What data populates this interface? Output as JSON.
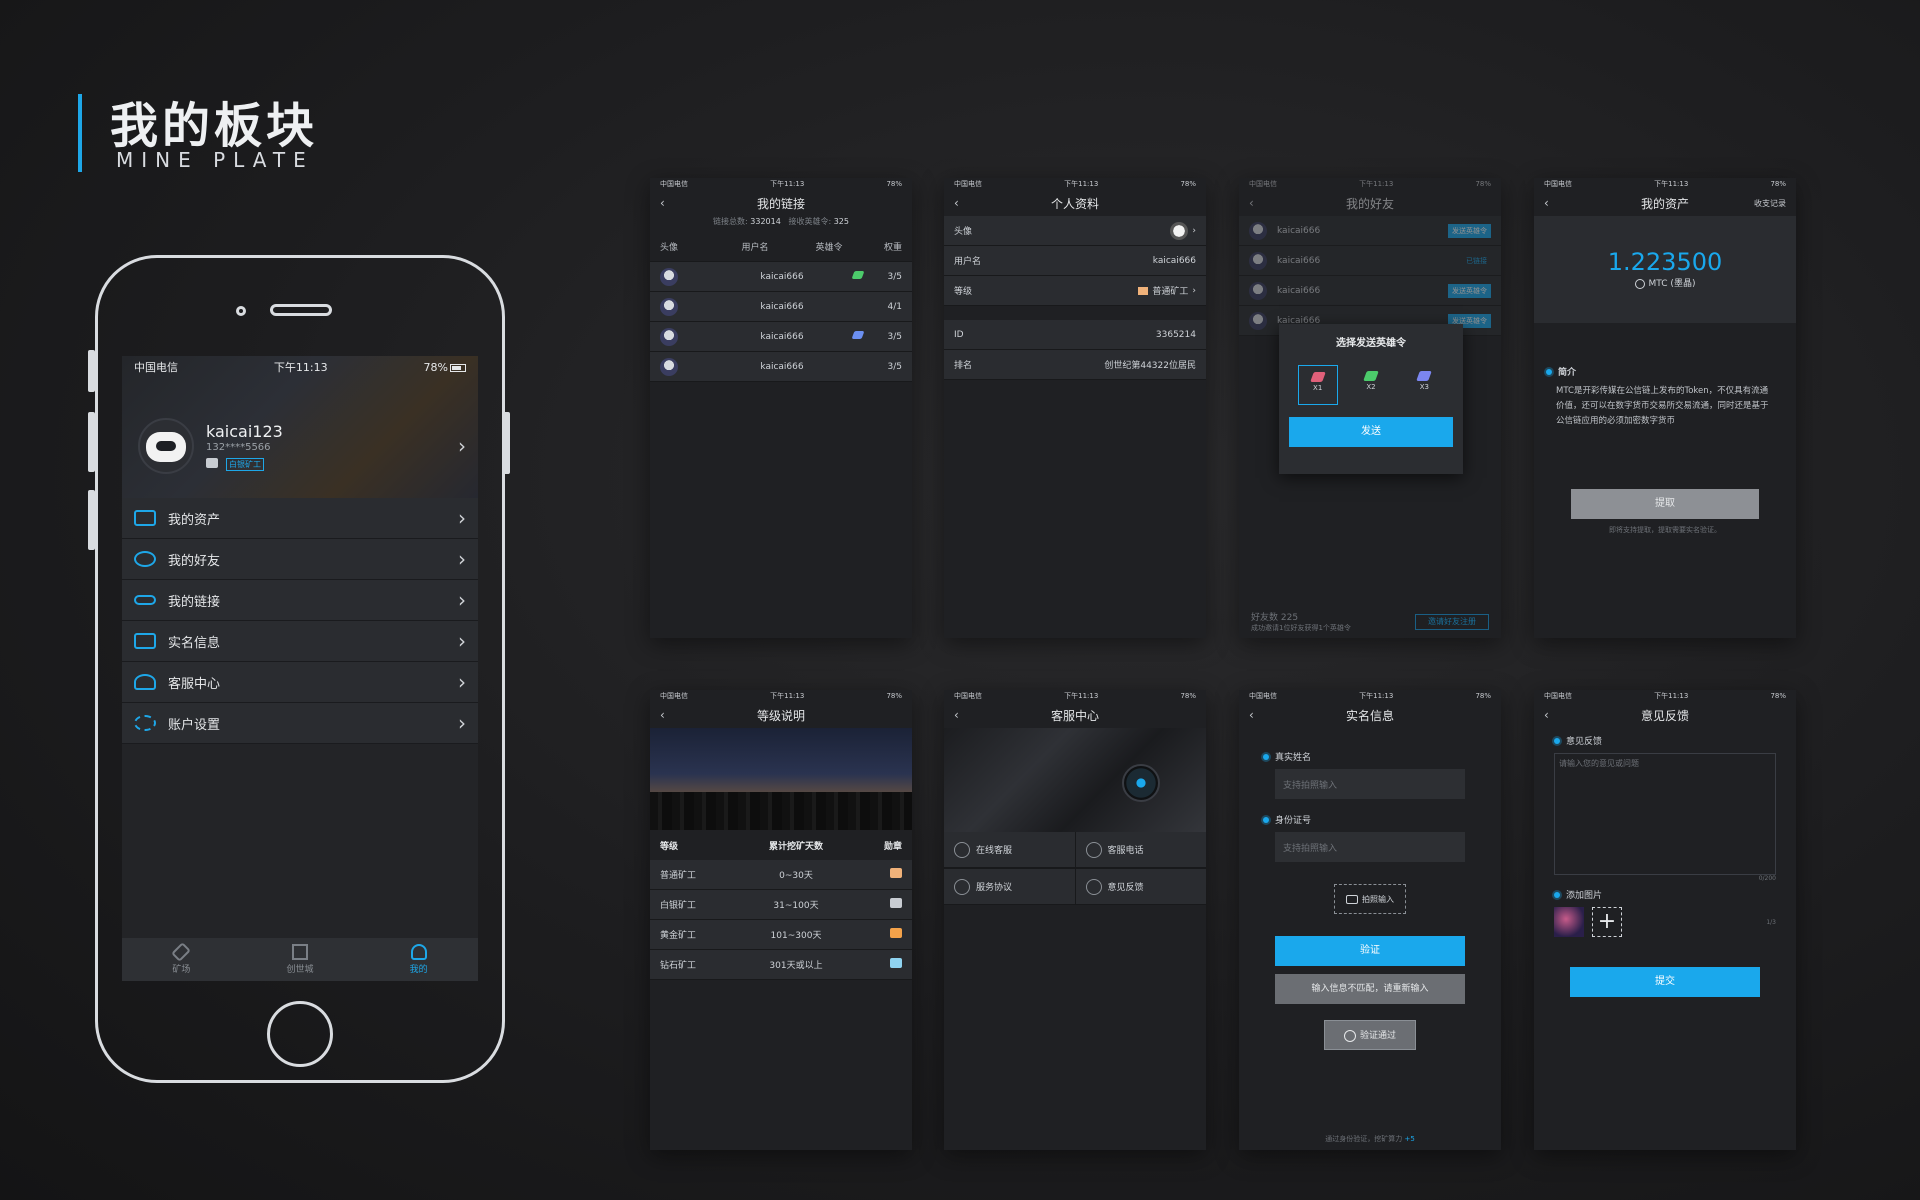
{
  "header": {
    "title_cn": "我的板块",
    "title_en": "MINE PLATE"
  },
  "status": {
    "carrier": "中国电信",
    "time": "下午11:13",
    "battery": "78%",
    "battery_level": 0.78
  },
  "main_phone": {
    "username": "kaicai123",
    "phone": "132****5566",
    "level_badge": "白银矿工",
    "menu": [
      {
        "label": "我的资产",
        "icon": "wallet-icon"
      },
      {
        "label": "我的好友",
        "icon": "friends-icon"
      },
      {
        "label": "我的链接",
        "icon": "link-icon"
      },
      {
        "label": "实名信息",
        "icon": "id-card-icon"
      },
      {
        "label": "客服中心",
        "icon": "headset-icon"
      },
      {
        "label": "账户设置",
        "icon": "gear-icon"
      }
    ],
    "tabs": [
      {
        "label": "矿场"
      },
      {
        "label": "创世城"
      },
      {
        "label": "我的"
      }
    ]
  },
  "links": {
    "title": "我的链接",
    "total_label": "链接总数:",
    "total": "332014",
    "received_label": "接收英雄令:",
    "received": "325",
    "columns": [
      "头像",
      "用户名",
      "英雄令",
      "权重"
    ],
    "rows": [
      {
        "name": "kaicai666",
        "weight": "3/5",
        "gem": "#4ccb6b"
      },
      {
        "name": "kaicai666",
        "weight": "4/1",
        "gem": ""
      },
      {
        "name": "kaicai666",
        "weight": "3/5",
        "gem": "#6b8ff0"
      },
      {
        "name": "kaicai666",
        "weight": "3/5",
        "gem": ""
      }
    ]
  },
  "profile": {
    "title": "个人资料",
    "rows": [
      {
        "k": "头像",
        "v": ""
      },
      {
        "k": "用户名",
        "v": "kaicai666"
      },
      {
        "k": "等级",
        "v": "普通矿工"
      },
      {
        "k": "ID",
        "v": "3365214"
      },
      {
        "k": "排名",
        "v": "创世纪第44322位居民"
      }
    ]
  },
  "friends": {
    "title": "我的好友",
    "rows": [
      {
        "name": "kaicai666",
        "action": "发送英雄令"
      },
      {
        "name": "kaicai666",
        "action": "已链接"
      },
      {
        "name": "kaicai666",
        "action": "发送英雄令"
      },
      {
        "name": "kaicai666",
        "action": "发送英雄令"
      }
    ],
    "dialog_title": "选择发送英雄令",
    "options": [
      "X1",
      "X2",
      "X3"
    ],
    "send": "发送",
    "count": "好友数 225",
    "hint": "成功邀请1位好友获得1个英雄令",
    "invite": "邀请好友注册"
  },
  "assets": {
    "title": "我的资产",
    "records": "收支记录",
    "amount": "1.223500",
    "unit": "MTC (墨晶)",
    "intro_title": "简介",
    "intro": "MTC是开彩传媒在公信链上发布的Token，不仅具有流通价值，还可以在数字货币交易所交易流通，同时还是基于公信链应用的必须加密数字货币",
    "withdraw": "提取",
    "withdraw_hint": "即将支持提取，提取需要实名验证。"
  },
  "levels": {
    "title": "等级说明",
    "columns": [
      "等级",
      "累计挖矿天数",
      "勋章"
    ],
    "rows": [
      {
        "level": "普通矿工",
        "days": "0~30天",
        "color": "#f0b27a"
      },
      {
        "level": "白银矿工",
        "days": "31~100天",
        "color": "#c8ccd2"
      },
      {
        "level": "黄金矿工",
        "days": "101~300天",
        "color": "#f3a24a"
      },
      {
        "level": "钻石矿工",
        "days": "301天或以上",
        "color": "#8fd3f0"
      }
    ]
  },
  "service": {
    "title": "客服中心",
    "items": [
      {
        "label": "在线客服"
      },
      {
        "label": "客服电话"
      },
      {
        "label": "服务协议"
      },
      {
        "label": "意见反馈"
      }
    ]
  },
  "realname": {
    "title": "实名信息",
    "name_label": "真实姓名",
    "name_ph": "支持拍照输入",
    "id_label": "身份证号",
    "id_ph": "支持拍照输入",
    "photo": "拍照输入",
    "verify": "验证",
    "mismatch": "输入信息不匹配，请重新输入",
    "passed": "验证通过",
    "footer": "通过身份验证，挖矿算力",
    "bonus": "+5"
  },
  "feedback": {
    "title": "意见反馈",
    "label": "意见反馈",
    "placeholder": "请输入您的意见或问题",
    "counter": "0/200",
    "img_label": "添加图片",
    "img_counter": "1/3",
    "submit": "提交"
  }
}
